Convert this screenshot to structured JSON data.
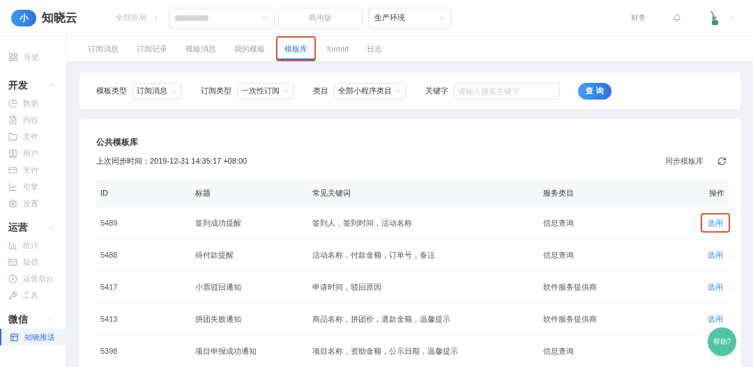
{
  "header": {
    "brand": "知晓云",
    "logo_char": "小",
    "breadcrumb": "全部应用",
    "edition": "商用版",
    "environment": "生产环境",
    "finance": "财务"
  },
  "sidebar": {
    "top_item": {
      "label": "导览",
      "selected": false
    },
    "sections": [
      {
        "title": "开发",
        "expanded": true,
        "items": [
          {
            "label": "数据",
            "selected": false
          },
          {
            "label": "内容",
            "selected": false
          },
          {
            "label": "文件",
            "selected": false
          },
          {
            "label": "用户",
            "selected": false
          },
          {
            "label": "支付",
            "selected": false
          },
          {
            "label": "引擎",
            "selected": false
          },
          {
            "label": "设置",
            "selected": false
          }
        ]
      },
      {
        "title": "运营",
        "expanded": true,
        "items": [
          {
            "label": "统计",
            "selected": false
          },
          {
            "label": "短信",
            "selected": false
          },
          {
            "label": "运营后台",
            "selected": false
          },
          {
            "label": "工具",
            "selected": false
          }
        ]
      },
      {
        "title": "微信",
        "expanded": true,
        "items": [
          {
            "label": "知晓推送",
            "selected": true
          }
        ]
      }
    ]
  },
  "tabs": [
    {
      "label": "订阅消息",
      "selected": false,
      "highlighted": false
    },
    {
      "label": "订阅记录",
      "selected": false,
      "highlighted": false
    },
    {
      "label": "模板消息",
      "selected": false,
      "highlighted": false
    },
    {
      "label": "我的模板",
      "selected": false,
      "highlighted": false
    },
    {
      "label": "模板库",
      "selected": true,
      "highlighted": true
    },
    {
      "label": "formId",
      "selected": false,
      "highlighted": false
    },
    {
      "label": "日志",
      "selected": false,
      "highlighted": false
    }
  ],
  "filters": [
    {
      "label": "模板类型",
      "value": "订阅消息"
    },
    {
      "label": "订阅类型",
      "value": "一次性订阅"
    },
    {
      "label": "类目",
      "value": "全部小程序类目"
    }
  ],
  "keyword": {
    "label": "关键字",
    "placeholder": "请输入搜索关键字"
  },
  "query_button": "查 询",
  "library": {
    "title": "公共模板库",
    "sync_time": "上次同步时间：2019-12-31 14:35:17 +08:00",
    "sync_label": "同步模板库"
  },
  "table": {
    "columns": [
      "ID",
      "标题",
      "常见关键词",
      "服务类目",
      "操作"
    ],
    "rows": [
      {
        "id": "5489",
        "title": "签到成功提醒",
        "keywords": "签到人，签到时间，活动名称",
        "category": "信息查询",
        "action": "选用",
        "highlighted": true
      },
      {
        "id": "5488",
        "title": "待付款提醒",
        "keywords": "活动名称，付款金额，订单号，备注",
        "category": "信息查询",
        "action": "选用",
        "highlighted": false
      },
      {
        "id": "5417",
        "title": "小票驳回通知",
        "keywords": "申请时间，驳回原因",
        "category": "软件服务提供商",
        "action": "选用",
        "highlighted": false
      },
      {
        "id": "5413",
        "title": "拼团失败通知",
        "keywords": "商品名称，拼团价，退款金额，温馨提示",
        "category": "软件服务提供商",
        "action": "选用",
        "highlighted": false
      },
      {
        "id": "5398",
        "title": "项目申报成功通知",
        "keywords": "项目名称，资助金额，公示日期，温馨提示",
        "category": "信息查询"
      }
    ]
  },
  "help_button": "帮助?"
}
